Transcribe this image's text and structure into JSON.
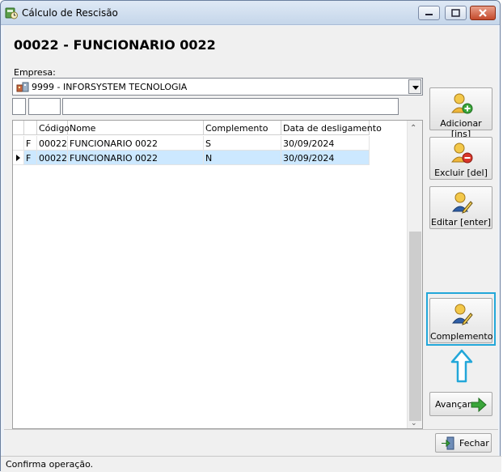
{
  "window": {
    "title": "Cálculo de Rescisão",
    "page_title": "00022 - FUNCIONARIO 0022"
  },
  "company": {
    "label": "Empresa:",
    "selected": "9999 - INFORSYSTEM TECNOLOGIA"
  },
  "grid": {
    "columns": [
      "",
      "Código",
      "Nome",
      "Complemento",
      "Data de desligamento"
    ],
    "rows": [
      {
        "type": "F",
        "code": "00022",
        "name": "FUNCIONARIO 0022",
        "complement": "S",
        "date": "30/09/2024"
      },
      {
        "type": "F",
        "code": "00022",
        "name": "FUNCIONARIO 0022",
        "complement": "N",
        "date": "30/09/2024"
      }
    ],
    "selected_row": 1
  },
  "actions": {
    "add": "Adicionar [ins]",
    "delete": "Excluir [del]",
    "edit": "Editar [enter]",
    "complement": "Complemento",
    "next": "Avançar",
    "close": "Fechar"
  },
  "icons": {
    "app": "calculator-clock-icon",
    "company": "company-building-icon",
    "add": "user-add-icon",
    "delete": "user-remove-icon",
    "edit": "user-edit-icon",
    "complement": "user-edit-icon",
    "next": "arrow-right-icon",
    "close": "exit-door-icon",
    "annotation": "arrow-up-outline-icon"
  },
  "colors": {
    "selection": "#cce8ff",
    "highlight": "#23a7d9",
    "green_arrow": "#3aa53a"
  },
  "status": {
    "text": "Confirma operação."
  }
}
